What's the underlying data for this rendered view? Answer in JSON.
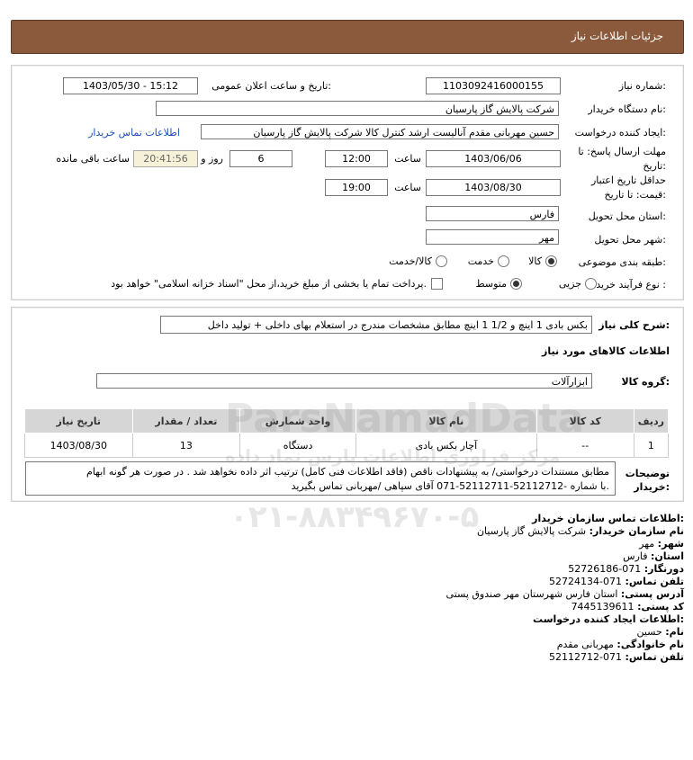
{
  "header": {
    "title": "جزئیات اطلاعات نیاز"
  },
  "details": {
    "need_number_label": "شماره نیاز:",
    "need_number": "1103092416000155",
    "announce_label": "تاریخ و ساعت اعلان عمومی:",
    "announce_value": "1403/05/30 - 15:12",
    "buyer_org_label": "نام دستگاه خریدار:",
    "buyer_org": "شرکت پالایش گاز پارسیان",
    "creator_label": "ایجاد کننده درخواست:",
    "creator": "حسین مهربانی مقدم آنالیست ارشد کنترل کالا  شرکت پالایش گاز پارسیان",
    "contact_link": "اطلاعات تماس خریدار",
    "deadline_label_1": "مهلت ارسال پاسخ: تا",
    "deadline_label_2": "تاریخ:",
    "deadline_date": "1403/06/06",
    "time_label": "ساعت",
    "deadline_time": "12:00",
    "days": "6",
    "days_label": "روز و",
    "remaining_timer": "20:41:56",
    "remaining_label": "ساعت باقی مانده",
    "validity_label_1": "حداقل تاریخ اعتبار",
    "validity_label_2": "قیمت: تا تاریخ:",
    "validity_date": "1403/08/30",
    "validity_time": "19:00",
    "province_label": "استان محل تحویل:",
    "province": "فارس",
    "city_label": "شهر محل تحویل:",
    "city": "مهر",
    "category_label": "طبقه بندی موضوعی:",
    "category_options": [
      "کالا",
      "خدمت",
      "کالا/خدمت"
    ],
    "category_selected": "کالا",
    "process_label": "نوع فرآیند خرید :",
    "process_options": [
      "جزیی",
      "متوسط"
    ],
    "process_selected": "متوسط",
    "payment_note": "پرداخت تمام یا بخشی از مبلغ خرید،از محل \"اسناد خزانه اسلامی\" خواهد بود."
  },
  "description": {
    "label": "شرح کلی نیاز:",
    "value": "بکس بادی 1 اینچ و 1/2 1 اینچ مطابق مشخصات مندرج در استعلام بهای داخلی + تولید داخل"
  },
  "goods": {
    "section_title": "اطلاعات کالاهای مورد نیاز",
    "group_label": "گروه کالا:",
    "group_value": "ابزارآلات",
    "columns": [
      "ردیف",
      "کد کالا",
      "نام کالا",
      "واحد شمارش",
      "تعداد / مقدار",
      "تاریخ نیاز"
    ],
    "rows": [
      {
        "row": "1",
        "code": "--",
        "name": "آچار بکس بادی",
        "unit": "دستگاه",
        "qty": "13",
        "date": "1403/08/30"
      }
    ]
  },
  "buyer_notes": {
    "label_1": "توضیحات",
    "label_2": "خریدار:",
    "line_1": "مطابق مستندات درخواستی/ به پیشنهادات ناقص (فاقد اطلاعات فنی کامل) ترتیب اثر داده نخواهد شد . در صورت هر گونه ابهام",
    "line_2": "با شماره -52112712-52112711-071 آقای سپاهی /مهربانی تماس بگیرید."
  },
  "contact": {
    "org_title": "اطلاعات تماس سازمان خریدار:",
    "buyer_name_label": "نام سازمان خریدار:",
    "buyer_name": "شرکت پالایش گاز پارسیان",
    "city_label": "شهر:",
    "city": "مهر",
    "province_label": "استان:",
    "province": "فارس",
    "fax_label": "دورنگار:",
    "fax": "071-52726186",
    "phone_label": "تلفن تماس:",
    "phone": "071-52724134",
    "address_label": "آدرس پستی:",
    "address": "استان فارس شهرستان مهر صندوق پستی",
    "postal_label": "کد پستی:",
    "postal": "7445139611",
    "creator_title": "اطلاعات ایجاد کننده درخواست:",
    "first_name_label": "نام:",
    "first_name": "حسین",
    "last_name_label": "نام خانوادگی:",
    "last_name": "مهربانی مقدم",
    "creator_phone_label": "تلفن تماس:",
    "creator_phone": "071-52112712"
  },
  "watermark": {
    "brand": "ParsNamadData",
    "fa_text": "مرکز فراوری اطلاعات پارس نماد داده",
    "phone": "۰۲۱-۸۸۳۴۹۶۷۰-۵"
  }
}
